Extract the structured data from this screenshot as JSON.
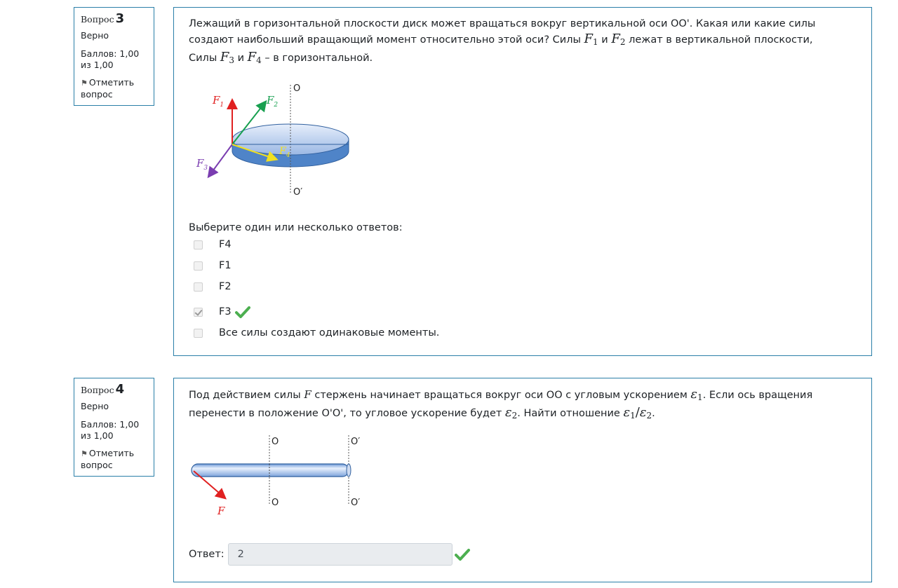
{
  "q3": {
    "info": {
      "label": "Вопрос",
      "number": "3",
      "state": "Верно",
      "grade": "Баллов: 1,00 из 1,00",
      "flag": "Отметить вопрос"
    },
    "text": {
      "line1": "Лежащий в горизонтальной плоскости диск может вращаться вокруг вертикальной оси OO'. Какая или какие силы",
      "line2_a": "создают наибольший вращающий момент относительно этой оси? Силы",
      "line2_b": "и",
      "line2_c": "лежат в вертикальной плоскости,",
      "line3_a": "Силы",
      "line3_b": "и",
      "line3_c": "– в горизонтальной."
    },
    "math": {
      "F": "F",
      "sub1": "1",
      "sub2": "2",
      "sub3": "3",
      "sub4": "4"
    },
    "figure": {
      "axis_top": "O",
      "axis_bottom": "O′",
      "f1": "F",
      "f2": "F",
      "f3": "F",
      "f4": "F",
      "s1": "1",
      "s2": "2",
      "s3": "3",
      "s4": "4",
      "colors": {
        "f1": "#e02020",
        "f2": "#18a050",
        "f3": "#7a3db0",
        "f4": "#f0e020",
        "disk": "#5b8ed0"
      }
    },
    "prompt": "Выберите один или несколько ответов:",
    "options": [
      {
        "label": "F4",
        "checked": false
      },
      {
        "label": "F1",
        "checked": false
      },
      {
        "label": "F2",
        "checked": false
      },
      {
        "label": "F3",
        "checked": true,
        "correct": true
      },
      {
        "label": "Все силы создают одинаковые моменты.",
        "checked": false
      }
    ]
  },
  "q4": {
    "info": {
      "label": "Вопрос",
      "number": "4",
      "state": "Верно",
      "grade": "Баллов: 1,00 из 1,00",
      "flag": "Отметить вопрос"
    },
    "text": {
      "line1_a": "Под действием силы",
      "line1_f": "F",
      "line1_b": "стержень начинает вращаться вокруг оси OO с угловым ускорением",
      "line1_c": ". Если ось вращения",
      "line2_a": "перенести в положение O'O', то угловое ускорение будет",
      "line2_b": ". Найти отношение",
      "line2_c": "."
    },
    "math": {
      "eps": "ε",
      "sub1": "1",
      "sub2": "2",
      "slash": "/"
    },
    "figure": {
      "axis1_top": "O",
      "axis1_bottom": "O",
      "axis2_top": "O′",
      "axis2_bottom": "O′",
      "force": "F"
    },
    "answer_label": "Ответ:",
    "answer_value": "2"
  },
  "colors": {
    "border": "#2a7fa8",
    "correct": "#4caf50"
  }
}
